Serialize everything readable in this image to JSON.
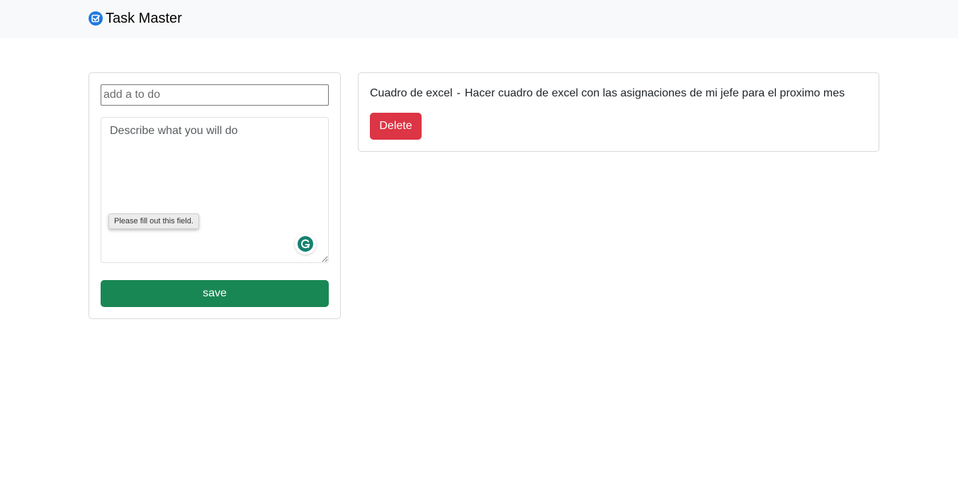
{
  "navbar": {
    "brand": "Task Master",
    "brand_icon": "checkbox-icon",
    "brand_color": "#1f7ae0"
  },
  "form": {
    "title_placeholder": "add a to do",
    "title_value": "",
    "description_placeholder": "Describe what you will do",
    "description_value": "",
    "validation_tooltip": "Please fill out this field.",
    "grammarly_icon": "grammarly-icon",
    "save_label": "save",
    "save_color": "#198754"
  },
  "tasks": [
    {
      "title": "Cuadro de excel",
      "separator": "-",
      "description": "Hacer cuadro de excel con las asignaciones de mi jefe para el proximo mes",
      "delete_label": "Delete",
      "delete_color": "#dc3545"
    }
  ]
}
